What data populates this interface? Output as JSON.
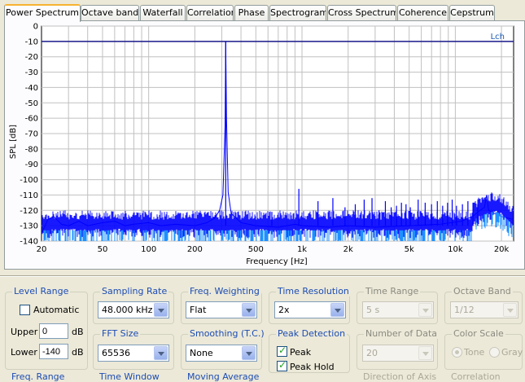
{
  "tabs": [
    {
      "label": "Power Spectrum",
      "active": true
    },
    {
      "label": "Octave band"
    },
    {
      "label": "Waterfall"
    },
    {
      "label": "Correlation"
    },
    {
      "label": "Phase"
    },
    {
      "label": "Spectrogram"
    },
    {
      "label": "Cross Spectrum"
    },
    {
      "label": "Coherence"
    },
    {
      "label": "Cepstrum"
    }
  ],
  "chart_data": {
    "type": "line",
    "title": "",
    "xlabel": "Frequency [Hz]",
    "ylabel": "SPL [dB]",
    "xscale": "log",
    "xlim": [
      20,
      24000
    ],
    "ylim": [
      -140,
      0
    ],
    "x_ticks": [
      20,
      50,
      100,
      200,
      500,
      1000,
      2000,
      5000,
      10000,
      20000
    ],
    "x_tick_labels": [
      "20",
      "50",
      "100",
      "200",
      "500",
      "1k",
      "2k",
      "5k",
      "10k",
      "20k"
    ],
    "y_ticks": [
      0,
      -10,
      -20,
      -30,
      -40,
      -50,
      -60,
      -70,
      -80,
      -90,
      -100,
      -110,
      -120,
      -130,
      -140
    ],
    "y_tick_labels": [
      "0",
      "-10",
      "-20",
      "-30",
      "-40",
      "-50",
      "-60",
      "-70",
      "-80",
      "-90",
      "-100",
      "-110",
      "-120",
      "-130",
      "-140"
    ],
    "grid": true,
    "colors": {
      "background": "#ffffff",
      "grid": "#c0c0c0",
      "reference": "#1a1a8c",
      "series": "#0000ff",
      "series_light": "#1e90ff"
    },
    "series": [
      {
        "name": "Lch",
        "reference_level": -10,
        "noise_floor": -130,
        "points": [
          {
            "x": 20,
            "y": -135
          },
          {
            "x": 22,
            "y": -126
          },
          {
            "x": 24,
            "y": -124
          },
          {
            "x": 27,
            "y": -129
          },
          {
            "x": 30,
            "y": -130
          },
          {
            "x": 35,
            "y": -127
          },
          {
            "x": 40,
            "y": -130
          },
          {
            "x": 50,
            "y": -128
          },
          {
            "x": 60,
            "y": -127
          },
          {
            "x": 70,
            "y": -130
          },
          {
            "x": 80,
            "y": -129
          },
          {
            "x": 100,
            "y": -128
          },
          {
            "x": 120,
            "y": -130
          },
          {
            "x": 150,
            "y": -129
          },
          {
            "x": 200,
            "y": -130
          },
          {
            "x": 240,
            "y": -128
          },
          {
            "x": 270,
            "y": -125
          },
          {
            "x": 290,
            "y": -120
          },
          {
            "x": 305,
            "y": -110
          },
          {
            "x": 315,
            "y": -65
          },
          {
            "x": 318,
            "y": -10
          },
          {
            "x": 322,
            "y": -60
          },
          {
            "x": 330,
            "y": -108
          },
          {
            "x": 345,
            "y": -122
          },
          {
            "x": 400,
            "y": -128
          },
          {
            "x": 500,
            "y": -130
          },
          {
            "x": 700,
            "y": -131
          },
          {
            "x": 900,
            "y": -129
          },
          {
            "x": 1000,
            "y": -130
          },
          {
            "x": 1500,
            "y": -131
          },
          {
            "x": 2000,
            "y": -130
          },
          {
            "x": 3000,
            "y": -131
          },
          {
            "x": 5000,
            "y": -130
          },
          {
            "x": 8000,
            "y": -129
          },
          {
            "x": 11000,
            "y": -127
          },
          {
            "x": 13000,
            "y": -124
          },
          {
            "x": 14500,
            "y": -120
          },
          {
            "x": 15500,
            "y": -118
          },
          {
            "x": 16000,
            "y": -110
          },
          {
            "x": 16500,
            "y": -120
          },
          {
            "x": 18000,
            "y": -122
          },
          {
            "x": 20000,
            "y": -124
          },
          {
            "x": 22000,
            "y": -125
          },
          {
            "x": 24000,
            "y": -126
          }
        ],
        "spurs": [
          {
            "x": 318,
            "y": -10
          },
          {
            "x": 636,
            "y": -121
          },
          {
            "x": 954,
            "y": -106
          },
          {
            "x": 1272,
            "y": -114
          },
          {
            "x": 1590,
            "y": -112
          },
          {
            "x": 1908,
            "y": -118
          },
          {
            "x": 2226,
            "y": -116
          },
          {
            "x": 2544,
            "y": -113
          },
          {
            "x": 2862,
            "y": -112
          },
          {
            "x": 3180,
            "y": -120
          },
          {
            "x": 3498,
            "y": -114
          },
          {
            "x": 3816,
            "y": -118
          },
          {
            "x": 4134,
            "y": -117
          },
          {
            "x": 4452,
            "y": -115
          },
          {
            "x": 4770,
            "y": -116
          },
          {
            "x": 5088,
            "y": -118
          },
          {
            "x": 5724,
            "y": -113
          },
          {
            "x": 6360,
            "y": -115
          },
          {
            "x": 6996,
            "y": -116
          },
          {
            "x": 7632,
            "y": -114
          },
          {
            "x": 8268,
            "y": -117
          },
          {
            "x": 8904,
            "y": -115
          },
          {
            "x": 9540,
            "y": -113
          },
          {
            "x": 10176,
            "y": -117
          },
          {
            "x": 11130,
            "y": -116
          },
          {
            "x": 12084,
            "y": -114
          },
          {
            "x": 13038,
            "y": -115
          },
          {
            "x": 14000,
            "y": -116
          }
        ]
      }
    ]
  },
  "controls": {
    "level_range": {
      "title": "Level Range",
      "automatic_label": "Automatic",
      "automatic_checked": false,
      "upper_label": "Upper",
      "upper_value": "0",
      "upper_unit": "dB",
      "lower_label": "Lower",
      "lower_value": "-140",
      "lower_unit": "dB"
    },
    "sampling_rate": {
      "title": "Sampling Rate",
      "value": "48.000 kHz"
    },
    "freq_weighting": {
      "title": "Freq. Weighting",
      "value": "Flat"
    },
    "time_resolution": {
      "title": "Time Resolution",
      "value": "2x"
    },
    "time_range": {
      "title": "Time Range",
      "value": "5 s",
      "enabled": false
    },
    "octave_band": {
      "title": "Octave Band",
      "value": "1/12",
      "enabled": false
    },
    "fft_size": {
      "title": "FFT Size",
      "value": "65536"
    },
    "smoothing": {
      "title": "Smoothing (T.C.)",
      "value": "None"
    },
    "peak_detection": {
      "title": "Peak Detection",
      "peak_label": "Peak",
      "peak_checked": true,
      "peak_hold_label": "Peak Hold",
      "peak_hold_checked": true
    },
    "number_of_data": {
      "title": "Number of Data",
      "value": "20",
      "enabled": false
    },
    "color_scale": {
      "title": "Color Scale",
      "tone_label": "Tone",
      "gray_label": "Gray",
      "selected": "tone",
      "enabled": false
    },
    "next_row_labels": [
      "Freq. Range",
      "Time Window",
      "Moving Average",
      "Direction of Axis",
      "Correlation"
    ]
  }
}
